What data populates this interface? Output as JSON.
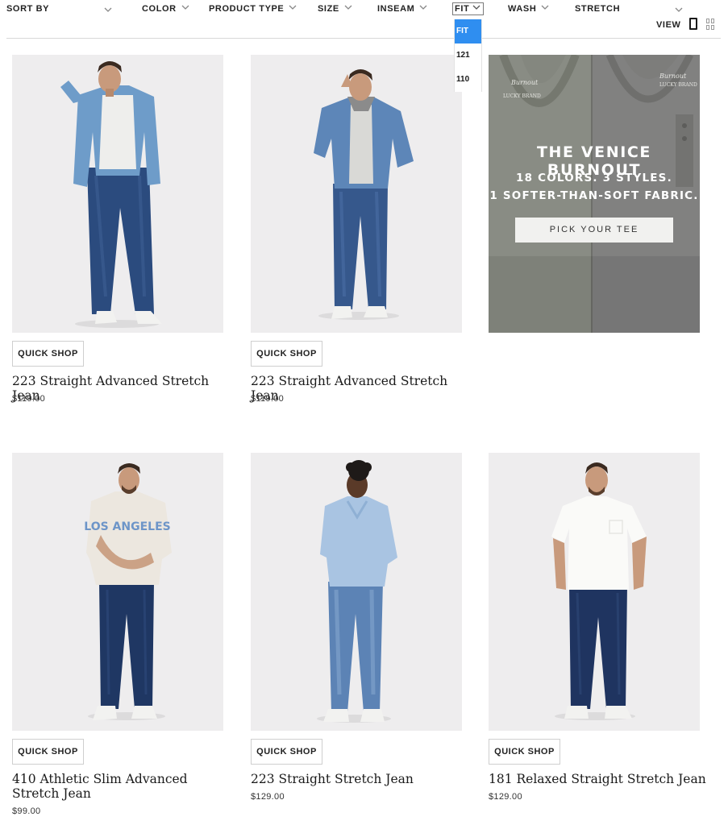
{
  "filters": {
    "sort_by": "SORT BY",
    "color": "COLOR",
    "product_type": "PRODUCT TYPE",
    "size": "SIZE",
    "inseam": "INSEAM",
    "fit": "FIT",
    "wash": "WASH",
    "stretch": "STRETCH"
  },
  "view": {
    "label": "VIEW",
    "icons": [
      "single-column-icon",
      "grid-icon"
    ]
  },
  "fit_dropdown": {
    "options": [
      "FIT",
      "121",
      "110"
    ],
    "selected_color": "#2f8ef0"
  },
  "promo": {
    "title": "THE VENICE BURNOUT",
    "line1": "18 COLORS. 3 STYLES.",
    "line2": "1 SOFTER-THAN-SOFT FABRIC.",
    "button": "PICK YOUR TEE",
    "tag1": "Burnout",
    "tag2": "LUCKY BRAND"
  },
  "products": [
    {
      "name": "223 Straight Advanced Stretch Jean",
      "price": "$119.00",
      "quick_shop": "QUICK SHOP"
    },
    {
      "name": "223 Straight Advanced Stretch Jean",
      "price": "$119.00",
      "quick_shop": "QUICK SHOP"
    },
    {
      "name": "410 Athletic Slim Advanced Stretch Jean",
      "price": "$99.00",
      "quick_shop": "QUICK SHOP"
    },
    {
      "name": "223 Straight Stretch Jean",
      "price": "$129.00",
      "quick_shop": "QUICK SHOP"
    },
    {
      "name": "181 Relaxed Straight Stretch Jean",
      "price": "$129.00",
      "quick_shop": "QUICK SHOP"
    }
  ],
  "product_photos": [
    {
      "top": "denim-shirt",
      "subject": "model-in-denim-shirt"
    },
    {
      "top": "denim-jacket",
      "subject": "model-in-denim-jacket"
    },
    {
      "top": "los-angeles-sweatshirt",
      "subject": "model-in-graphic-sweatshirt",
      "print": "LOS ANGELES"
    },
    {
      "top": "chambray-shirt",
      "subject": "model-in-chambray-shirt"
    },
    {
      "top": "white-tee",
      "subject": "model-in-white-tee"
    }
  ]
}
